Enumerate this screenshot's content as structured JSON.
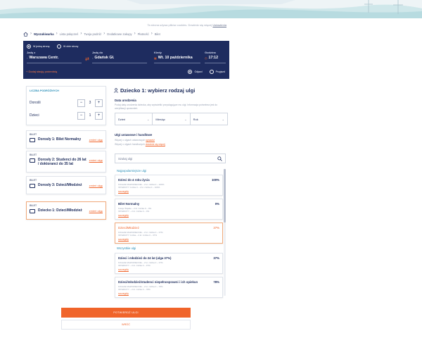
{
  "top_note": {
    "text": "Ta strona używa plików cookies. Dowiedz się więcej",
    "link": "Ustawienia"
  },
  "breadcrumb": [
    "Wyszukiwarka",
    "Lista połączeń",
    "Twoja podróż",
    "Dodatkowe zakupy",
    "Płatność",
    "Bilet"
  ],
  "search": {
    "trip_type": {
      "one_way": "W jedną stronę",
      "return": "W obie strony"
    },
    "from": {
      "label": "Jadę z",
      "value": "Warszawa Centr."
    },
    "to": {
      "label": "Jadę do",
      "value": "Gdańsk Gł."
    },
    "date": {
      "label": "Kiedy",
      "value": "Wt. 10 października"
    },
    "time": {
      "label": "Godzina",
      "value": "17:12"
    },
    "add_stop": "+  Dodaj stację pośrednią",
    "departure": "Odjazd",
    "arrival": "Przyjazd"
  },
  "passengers": {
    "caption": "LICZBA PODRÓŻNYCH",
    "adults": {
      "label": "Dorośli",
      "count": "3"
    },
    "children": {
      "label": "Dzieci",
      "count": "1"
    }
  },
  "tickets": [
    {
      "caption": "BILET",
      "text": "Dorosły 1: Bilet Normalny",
      "link": "zmień ulgę"
    },
    {
      "caption": "BILET",
      "text": "Dorosły 2: Studenci do 26 lat / doktoranci do 35 lat",
      "link": "zmień ulgę"
    },
    {
      "caption": "BILET",
      "text": "Dorosły 3: Dzieci/Młodzież",
      "link": "zmień ulgę"
    },
    {
      "caption": "BILET",
      "text": "Dziecko 1: Dzieci/Młodzież",
      "link": "zmień ulgę"
    }
  ],
  "panel": {
    "title": "Dziecko 1: wybierz rodzaj ulgi",
    "dob_label": "Data urodzenia",
    "dob_hint": "Podaj datę urodzenia dziecka, aby wyświetlić przysługujące mu ulgi. Informacja potrzebna jest do weryfikacji uprawnień.",
    "dob": {
      "day": "Dzień",
      "month": "Miesiąc",
      "year": "Rok"
    },
    "discounts_label": "Ulgi ustawowe i handlowe",
    "discounts_hint1": "Więcej o ulgach ustawowych",
    "discounts_link1": "sprawdź",
    "discounts_hint2": "Więcej o ulgach handlowych",
    "discounts_link2": "dowiedz się więcej",
    "search_placeholder": "Szukaj ulgi",
    "group_popular": "Najpopularniejsze ulgi",
    "group_all": "Wszystkie ulgi"
  },
  "discounts": [
    {
      "name": "Dzieci do 4 roku życia",
      "pct": "100%",
      "l1": "KOLEJE MAZOWIECKIE – 2 kl. zniżka 0 – 100%",
      "l2": "INTERCITY zniżka 0 – 2 kl. zniżka 0 – 100%",
      "more": "szczegóły"
    },
    {
      "name": "Bilet Normalny",
      "pct": "0%",
      "l1": "Koleje Śląskie – 2 kl. zniżka 0 – 0%",
      "l2": "INTERCITY – 2 kl. zniżka 0 – 0%",
      "more": "szczegóły"
    },
    {
      "name": "Dzieci/Młodzież",
      "pct": "37%",
      "l1": "KOLEJE MAZOWIECKIE – 2 kl. zniżka 0 – 37%",
      "l2": "INTERCITY zniżka – 2 kl. zniżka 0 – 37%",
      "more": "szczegóły"
    },
    {
      "name": "Dzieci i młodzież do 24 lat (ulga 37%)",
      "pct": "37%",
      "l1": "KOLEJE MAZOWIECKIE – 2 kl. zniżka 0 – 37%",
      "l2": "INTERCITY – 2 kl. zniżka 0 – 37%",
      "more": "szczegóły"
    },
    {
      "name": "Dzieci/młodzież/studenci niepełnosprawni i ich opiekun",
      "pct": "78%",
      "l1": "KOLEJE MAZOWIECKIE – 2 kl. zniżka 0 – 78%",
      "l2": "INTERCITY – 2 kl. zniżka 0 – 78%",
      "more": "szczegóły"
    }
  ],
  "buttons": {
    "confirm": "POTWIERDŹ ULGI",
    "back": "WRÓĆ"
  },
  "colors": {
    "navy": "#1e2c5f",
    "orange": "#f0642a",
    "teal": "#2b8fb8"
  }
}
